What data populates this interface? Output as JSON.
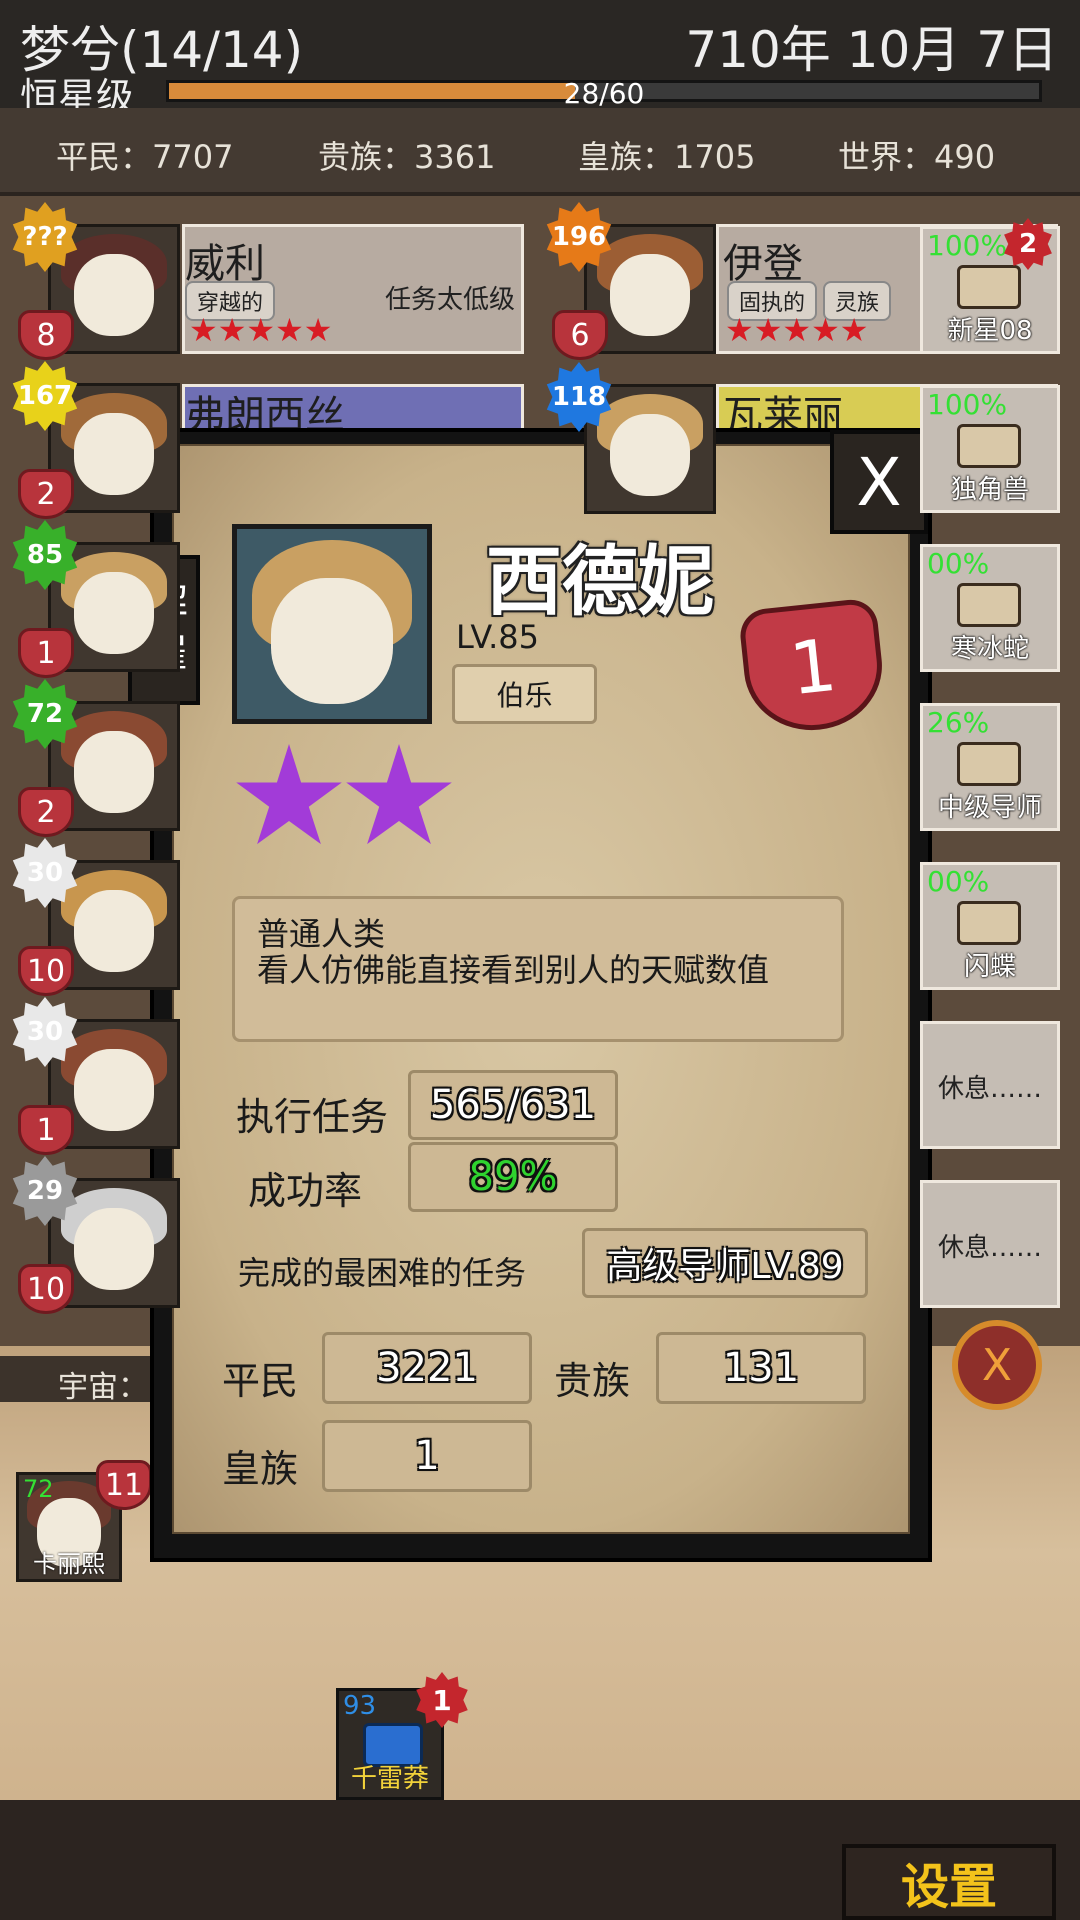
{
  "header": {
    "org_name": "梦兮(14/14)",
    "date": "710年 10月 7日",
    "rank": "恒星级",
    "progress_text": "28/60",
    "progress_fraction": 0.467
  },
  "counts": {
    "commoner": "平民：7707",
    "noble": "贵族：3361",
    "royal": "皇族：1705",
    "world": "世界：490"
  },
  "roster_left": [
    {
      "badge": "???",
      "hearts": "8",
      "badge_color": "#e0a020"
    },
    {
      "badge": "167",
      "hearts": "2",
      "badge_color": "#e8d21a"
    },
    {
      "badge": "85",
      "hearts": "1",
      "badge_color": "#38b02a"
    },
    {
      "badge": "72",
      "hearts": "2",
      "badge_color": "#38b02a"
    },
    {
      "badge": "30",
      "hearts": "10",
      "badge_color": "#e8e8e8"
    },
    {
      "badge": "30",
      "hearts": "1",
      "badge_color": "#e8e8e8"
    },
    {
      "badge": "29",
      "hearts": "10",
      "badge_color": "#9a9a9a"
    }
  ],
  "roster_right": [
    {
      "badge": "196",
      "hearts": "6",
      "badge_color": "#e67a18"
    },
    {
      "badge": "118",
      "badge_color": "#1f78e0"
    }
  ],
  "card_willy": {
    "name": "威利",
    "tag1": "穿越的",
    "status": "任务太低级"
  },
  "card_idan": {
    "name": "伊登",
    "tag1": "固执的",
    "tag2": "灵族"
  },
  "card_frances": {
    "name": "弗朗西丝"
  },
  "card_valerie": {
    "name": "瓦莱丽"
  },
  "tasks": [
    {
      "pct": "100%",
      "name": "新星08",
      "count": "2"
    },
    {
      "pct": "100%",
      "name": "独角兽"
    },
    {
      "pct": "00%",
      "name": "寒冰蛇"
    },
    {
      "pct": "26%",
      "name": "中级导师"
    },
    {
      "pct": "00%",
      "name": "闪蝶"
    },
    {
      "name": "休息……"
    },
    {
      "name": "休息……"
    }
  ],
  "modal": {
    "close_label": "X",
    "dismiss_label": "解雇",
    "name": "西德妮",
    "level": "LV.85",
    "trait": "伯乐",
    "heart_count": "1",
    "stars": 2,
    "desc_line1": "普通人类",
    "desc_line2": "看人仿佛能直接看到别人的天赋数值",
    "missions_label": "执行任务",
    "missions_value": "565/631",
    "rate_label": "成功率",
    "rate_value": "89%",
    "hardest_label": "完成的最困难的任务",
    "hardest_value": "高级导师LV.89",
    "commoner_label": "平民",
    "commoner_value": "3221",
    "noble_label": "贵族",
    "noble_value": "131",
    "royal_label": "皇族",
    "royal_value": "1"
  },
  "bottom": {
    "universe_label": "宇宙：2",
    "hero_level": "72",
    "hero_hearts": "11",
    "hero_name": "卡丽熙",
    "mission_level": "93",
    "mission_count": "1",
    "mission_name": "千雷莽",
    "settings_label": "设置",
    "cancel_icon": "X"
  },
  "colors": {
    "progress_fill": "#d88b3b",
    "star_purple": "#a23bd8",
    "success_green": "#2fd32f",
    "settings_gold": "#f3c31b"
  }
}
